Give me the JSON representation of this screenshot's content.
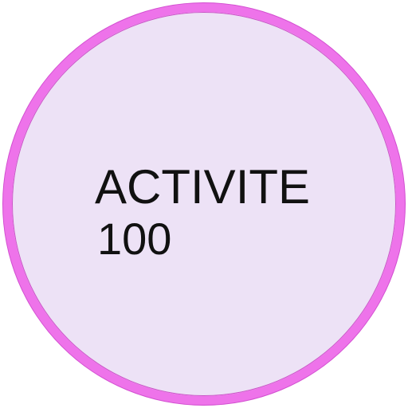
{
  "badge": {
    "title": "ACTIVITE",
    "value": "100",
    "ring_color": "#ee73ea",
    "fill_color": "#ede2f6",
    "text_color": "#111111"
  }
}
